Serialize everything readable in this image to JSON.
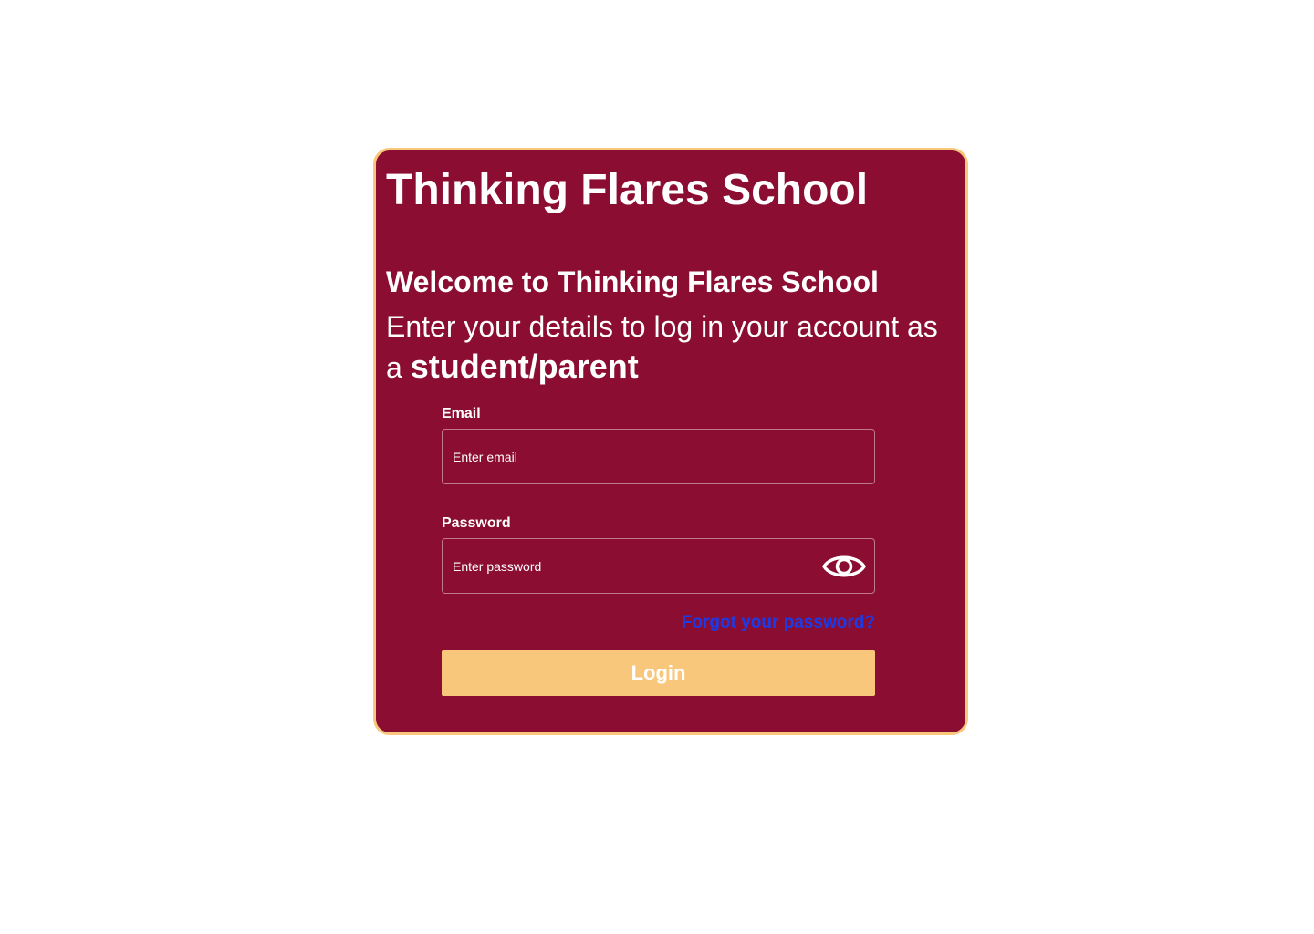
{
  "header": {
    "school_name": "Thinking Flares School"
  },
  "intro": {
    "welcome": "Welcome to Thinking Flares School",
    "instruction_prefix": "Enter your details to log in your account as a ",
    "role": "student/parent"
  },
  "form": {
    "email": {
      "label": "Email",
      "placeholder": "Enter email",
      "value": ""
    },
    "password": {
      "label": "Password",
      "placeholder": "Enter password",
      "value": "",
      "toggle_icon": "eye-icon"
    },
    "forgot_password_label": "Forgot your password?",
    "login_label": "Login"
  },
  "colors": {
    "card_background": "#8b0e32",
    "card_border": "#f9c77c",
    "button_background": "#f9c77c",
    "link": "#1a3be8",
    "text": "#ffffff"
  }
}
